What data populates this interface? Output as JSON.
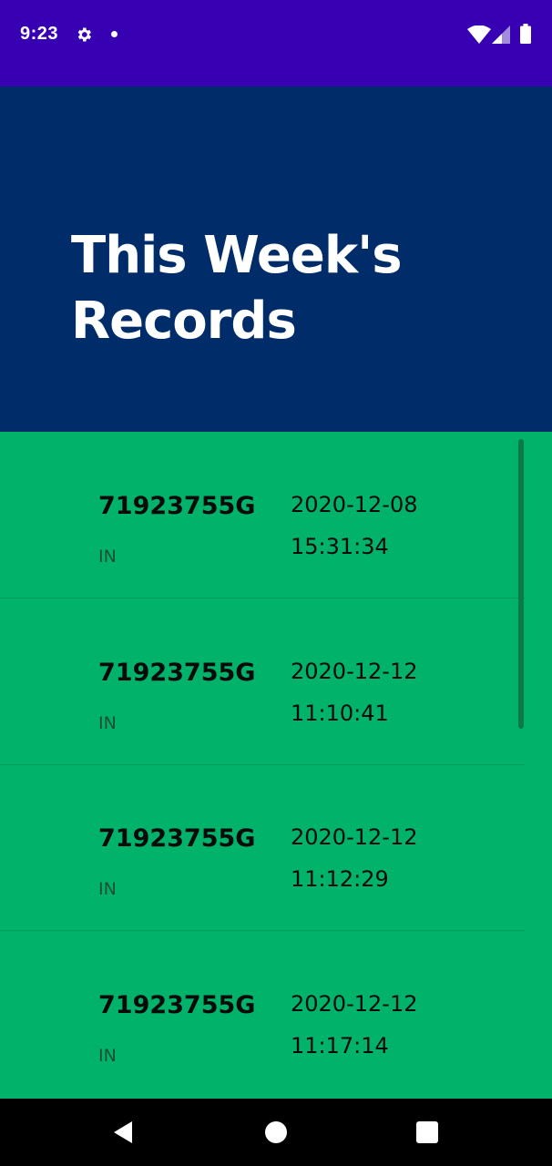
{
  "status_bar": {
    "time": "9:23",
    "icons": [
      "gear-icon",
      "notification-dot-icon",
      "wifi-icon",
      "signal-icon",
      "battery-icon"
    ],
    "background_color": "#3700B3"
  },
  "header": {
    "title": "This Week's Records",
    "background_color": "#002D6A"
  },
  "records": [
    {
      "id": "71923755G",
      "type": "IN",
      "date": "2020-12-08",
      "time": "15:31:34"
    },
    {
      "id": "71923755G",
      "type": "IN",
      "date": "2020-12-12",
      "time": "11:10:41"
    },
    {
      "id": "71923755G",
      "type": "IN",
      "date": "2020-12-12",
      "time": "11:12:29"
    },
    {
      "id": "71923755G",
      "type": "IN",
      "date": "2020-12-12",
      "time": "11:17:14"
    }
  ],
  "list_background_color": "#00B26A",
  "nav_bar": {
    "icons": [
      "back-icon",
      "home-icon",
      "recents-icon"
    ]
  }
}
